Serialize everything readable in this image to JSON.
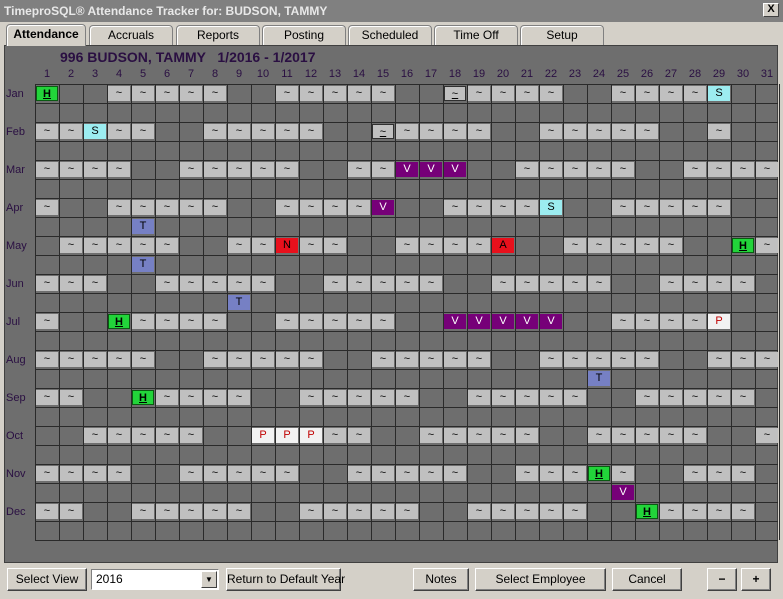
{
  "window": {
    "title": "TimeproSQL® Attendance Tracker for: BUDSON, TAMMY",
    "close_label": "X"
  },
  "tabs": [
    {
      "label": "Attendance",
      "active": true
    },
    {
      "label": "Accruals",
      "active": false
    },
    {
      "label": "Reports",
      "active": false
    },
    {
      "label": "Posting",
      "active": false
    },
    {
      "label": "Scheduled",
      "active": false
    },
    {
      "label": "Time Off",
      "active": false
    },
    {
      "label": "Setup",
      "active": false
    }
  ],
  "heading": "996 BUDSON, TAMMY   1/2016 - 1/2017",
  "days": [
    "1",
    "2",
    "3",
    "4",
    "5",
    "6",
    "7",
    "8",
    "9",
    "10",
    "11",
    "12",
    "13",
    "14",
    "15",
    "16",
    "17",
    "18",
    "19",
    "20",
    "21",
    "22",
    "23",
    "24",
    "25",
    "26",
    "27",
    "28",
    "29",
    "30",
    "31"
  ],
  "months": [
    "Jan",
    "Feb",
    "Mar",
    "Apr",
    "May",
    "Jun",
    "Jul",
    "Aug",
    "Sep",
    "Oct",
    "Nov",
    "Dec"
  ],
  "calendar_rows": [
    [
      [
        "H",
        "holiday"
      ],
      [
        "",
        "none"
      ],
      [
        "",
        "none"
      ],
      [
        "~",
        "sched"
      ],
      [
        "~",
        "sched"
      ],
      [
        "~",
        "sched"
      ],
      [
        "~",
        "sched"
      ],
      [
        "~",
        "sched"
      ],
      [
        "",
        "none"
      ],
      [
        "",
        "none"
      ],
      [
        "~",
        "sched"
      ],
      [
        "~",
        "sched"
      ],
      [
        "~",
        "sched"
      ],
      [
        "~",
        "sched"
      ],
      [
        "~",
        "sched"
      ],
      [
        "",
        "none"
      ],
      [
        "",
        "none"
      ],
      [
        "~",
        "today"
      ],
      [
        "~",
        "sched"
      ],
      [
        "~",
        "sched"
      ],
      [
        "~",
        "sched"
      ],
      [
        "~",
        "sched"
      ],
      [
        "",
        "none"
      ],
      [
        "",
        "none"
      ],
      [
        "~",
        "sched"
      ],
      [
        "~",
        "sched"
      ],
      [
        "~",
        "sched"
      ],
      [
        "~",
        "sched"
      ],
      [
        "S",
        "sick"
      ],
      [
        "",
        "none"
      ],
      [
        "",
        "none"
      ]
    ],
    [
      [
        "~",
        "sched"
      ],
      [
        "~",
        "sched"
      ],
      [
        "S",
        "sick"
      ],
      [
        "~",
        "sched"
      ],
      [
        "~",
        "sched"
      ],
      [
        "",
        "none"
      ],
      [
        "",
        "none"
      ],
      [
        "~",
        "sched"
      ],
      [
        "~",
        "sched"
      ],
      [
        "~",
        "sched"
      ],
      [
        "~",
        "sched"
      ],
      [
        "~",
        "sched"
      ],
      [
        "",
        "none"
      ],
      [
        "",
        "none"
      ],
      [
        "~",
        "today"
      ],
      [
        "~",
        "sched"
      ],
      [
        "~",
        "sched"
      ],
      [
        "~",
        "sched"
      ],
      [
        "~",
        "sched"
      ],
      [
        "",
        "none"
      ],
      [
        "",
        "none"
      ],
      [
        "~",
        "sched"
      ],
      [
        "~",
        "sched"
      ],
      [
        "~",
        "sched"
      ],
      [
        "~",
        "sched"
      ],
      [
        "~",
        "sched"
      ],
      [
        "",
        "none"
      ],
      [
        "",
        "none"
      ],
      [
        "~",
        "sched"
      ],
      [
        "",
        "none"
      ],
      [
        "",
        "none"
      ]
    ],
    [
      [
        "~",
        "sched"
      ],
      [
        "~",
        "sched"
      ],
      [
        "~",
        "sched"
      ],
      [
        "~",
        "sched"
      ],
      [
        "",
        "none"
      ],
      [
        "",
        "none"
      ],
      [
        "~",
        "sched"
      ],
      [
        "~",
        "sched"
      ],
      [
        "~",
        "sched"
      ],
      [
        "~",
        "sched"
      ],
      [
        "~",
        "sched"
      ],
      [
        "",
        "none"
      ],
      [
        "",
        "none"
      ],
      [
        "~",
        "sched"
      ],
      [
        "~",
        "sched"
      ],
      [
        "V",
        "vac"
      ],
      [
        "V",
        "vac"
      ],
      [
        "V",
        "vac"
      ],
      [
        "",
        "none"
      ],
      [
        "",
        "none"
      ],
      [
        "~",
        "sched"
      ],
      [
        "~",
        "sched"
      ],
      [
        "~",
        "sched"
      ],
      [
        "~",
        "sched"
      ],
      [
        "~",
        "sched"
      ],
      [
        "",
        "none"
      ],
      [
        "",
        "none"
      ],
      [
        "~",
        "sched"
      ],
      [
        "~",
        "sched"
      ],
      [
        "~",
        "sched"
      ],
      [
        "~",
        "sched"
      ]
    ],
    [
      [
        "~",
        "sched"
      ],
      [
        "",
        "none"
      ],
      [
        "",
        "none"
      ],
      [
        "~",
        "sched"
      ],
      [
        "~",
        "sched"
      ],
      [
        "~",
        "sched"
      ],
      [
        "~",
        "sched"
      ],
      [
        "~",
        "sched"
      ],
      [
        "",
        "none"
      ],
      [
        "",
        "none"
      ],
      [
        "~",
        "sched"
      ],
      [
        "~",
        "sched"
      ],
      [
        "~",
        "sched"
      ],
      [
        "~",
        "sched"
      ],
      [
        "V",
        "vac"
      ],
      [
        "",
        "none"
      ],
      [
        "",
        "none"
      ],
      [
        "~",
        "sched"
      ],
      [
        "~",
        "sched"
      ],
      [
        "~",
        "sched"
      ],
      [
        "~",
        "sched"
      ],
      [
        "S",
        "sick"
      ],
      [
        "",
        "none"
      ],
      [
        "",
        "none"
      ],
      [
        "~",
        "sched"
      ],
      [
        "~",
        "sched"
      ],
      [
        "~",
        "sched"
      ],
      [
        "~",
        "sched"
      ],
      [
        "~",
        "sched"
      ],
      [
        "",
        "none"
      ],
      [
        "",
        "none"
      ]
    ],
    [
      [
        "",
        "none"
      ],
      [
        "~",
        "sched"
      ],
      [
        "~",
        "sched"
      ],
      [
        "~",
        "sched"
      ],
      [
        "~",
        "sched"
      ],
      [
        "~",
        "sched"
      ],
      [
        "",
        "none"
      ],
      [
        "",
        "none"
      ],
      [
        "~",
        "sched"
      ],
      [
        "~",
        "sched"
      ],
      [
        "N",
        "noshow"
      ],
      [
        "~",
        "sched"
      ],
      [
        "~",
        "sched"
      ],
      [
        "",
        "none"
      ],
      [
        "",
        "none"
      ],
      [
        "~",
        "sched"
      ],
      [
        "~",
        "sched"
      ],
      [
        "~",
        "sched"
      ],
      [
        "~",
        "sched"
      ],
      [
        "A",
        "absent"
      ],
      [
        "",
        "none"
      ],
      [
        "",
        "none"
      ],
      [
        "~",
        "sched"
      ],
      [
        "~",
        "sched"
      ],
      [
        "~",
        "sched"
      ],
      [
        "~",
        "sched"
      ],
      [
        "~",
        "sched"
      ],
      [
        "",
        "none"
      ],
      [
        "",
        "none"
      ],
      [
        "H",
        "holiday"
      ],
      [
        "~",
        "sched"
      ]
    ],
    [
      [
        "~",
        "sched"
      ],
      [
        "~",
        "sched"
      ],
      [
        "~",
        "sched"
      ],
      [
        "",
        "none"
      ],
      [
        "",
        "none"
      ],
      [
        "~",
        "sched"
      ],
      [
        "~",
        "sched"
      ],
      [
        "~",
        "sched"
      ],
      [
        "~",
        "sched"
      ],
      [
        "~",
        "sched"
      ],
      [
        "",
        "none"
      ],
      [
        "",
        "none"
      ],
      [
        "~",
        "sched"
      ],
      [
        "~",
        "sched"
      ],
      [
        "~",
        "sched"
      ],
      [
        "~",
        "sched"
      ],
      [
        "~",
        "sched"
      ],
      [
        "",
        "none"
      ],
      [
        "",
        "none"
      ],
      [
        "~",
        "sched"
      ],
      [
        "~",
        "sched"
      ],
      [
        "~",
        "sched"
      ],
      [
        "~",
        "sched"
      ],
      [
        "~",
        "sched"
      ],
      [
        "",
        "none"
      ],
      [
        "",
        "none"
      ],
      [
        "~",
        "sched"
      ],
      [
        "~",
        "sched"
      ],
      [
        "~",
        "sched"
      ],
      [
        "~",
        "sched"
      ],
      [
        "",
        "none"
      ]
    ],
    [
      [
        "~",
        "sched"
      ],
      [
        "",
        "none"
      ],
      [
        "",
        "none"
      ],
      [
        "H",
        "holiday"
      ],
      [
        "~",
        "sched"
      ],
      [
        "~",
        "sched"
      ],
      [
        "~",
        "sched"
      ],
      [
        "~",
        "sched"
      ],
      [
        "",
        "none"
      ],
      [
        "",
        "none"
      ],
      [
        "~",
        "sched"
      ],
      [
        "~",
        "sched"
      ],
      [
        "~",
        "sched"
      ],
      [
        "~",
        "sched"
      ],
      [
        "~",
        "sched"
      ],
      [
        "",
        "none"
      ],
      [
        "",
        "none"
      ],
      [
        "V",
        "vac"
      ],
      [
        "V",
        "vac"
      ],
      [
        "V",
        "vac"
      ],
      [
        "V",
        "vac"
      ],
      [
        "V",
        "vac"
      ],
      [
        "",
        "none"
      ],
      [
        "",
        "none"
      ],
      [
        "~",
        "sched"
      ],
      [
        "~",
        "sched"
      ],
      [
        "~",
        "sched"
      ],
      [
        "~",
        "sched"
      ],
      [
        "P",
        "personal"
      ],
      [
        "",
        "none"
      ],
      [
        "",
        "none"
      ]
    ],
    [
      [
        "~",
        "sched"
      ],
      [
        "~",
        "sched"
      ],
      [
        "~",
        "sched"
      ],
      [
        "~",
        "sched"
      ],
      [
        "~",
        "sched"
      ],
      [
        "",
        "none"
      ],
      [
        "",
        "none"
      ],
      [
        "~",
        "sched"
      ],
      [
        "~",
        "sched"
      ],
      [
        "~",
        "sched"
      ],
      [
        "~",
        "sched"
      ],
      [
        "~",
        "sched"
      ],
      [
        "",
        "none"
      ],
      [
        "",
        "none"
      ],
      [
        "~",
        "sched"
      ],
      [
        "~",
        "sched"
      ],
      [
        "~",
        "sched"
      ],
      [
        "~",
        "sched"
      ],
      [
        "~",
        "sched"
      ],
      [
        "",
        "none"
      ],
      [
        "",
        "none"
      ],
      [
        "~",
        "sched"
      ],
      [
        "~",
        "sched"
      ],
      [
        "~",
        "sched"
      ],
      [
        "~",
        "sched"
      ],
      [
        "~",
        "sched"
      ],
      [
        "",
        "none"
      ],
      [
        "",
        "none"
      ],
      [
        "~",
        "sched"
      ],
      [
        "~",
        "sched"
      ],
      [
        "~",
        "sched"
      ]
    ],
    [
      [
        "~",
        "sched"
      ],
      [
        "~",
        "sched"
      ],
      [
        "",
        "none"
      ],
      [
        "",
        "none"
      ],
      [
        "H",
        "holiday"
      ],
      [
        "~",
        "sched"
      ],
      [
        "~",
        "sched"
      ],
      [
        "~",
        "sched"
      ],
      [
        "~",
        "sched"
      ],
      [
        "",
        "none"
      ],
      [
        "",
        "none"
      ],
      [
        "~",
        "sched"
      ],
      [
        "~",
        "sched"
      ],
      [
        "~",
        "sched"
      ],
      [
        "~",
        "sched"
      ],
      [
        "~",
        "sched"
      ],
      [
        "",
        "none"
      ],
      [
        "",
        "none"
      ],
      [
        "~",
        "sched"
      ],
      [
        "~",
        "sched"
      ],
      [
        "~",
        "sched"
      ],
      [
        "~",
        "sched"
      ],
      [
        "~",
        "sched"
      ],
      [
        "",
        "none"
      ],
      [
        "",
        "none"
      ],
      [
        "~",
        "sched"
      ],
      [
        "~",
        "sched"
      ],
      [
        "~",
        "sched"
      ],
      [
        "~",
        "sched"
      ],
      [
        "~",
        "sched"
      ],
      [
        "",
        "none"
      ]
    ],
    [
      [
        "",
        "none"
      ],
      [
        "",
        "none"
      ],
      [
        "~",
        "sched"
      ],
      [
        "~",
        "sched"
      ],
      [
        "~",
        "sched"
      ],
      [
        "~",
        "sched"
      ],
      [
        "~",
        "sched"
      ],
      [
        "",
        "none"
      ],
      [
        "",
        "none"
      ],
      [
        "P",
        "personal"
      ],
      [
        "P",
        "personal"
      ],
      [
        "P",
        "personal"
      ],
      [
        "~",
        "sched"
      ],
      [
        "~",
        "sched"
      ],
      [
        "",
        "none"
      ],
      [
        "",
        "none"
      ],
      [
        "~",
        "sched"
      ],
      [
        "~",
        "sched"
      ],
      [
        "~",
        "sched"
      ],
      [
        "~",
        "sched"
      ],
      [
        "~",
        "sched"
      ],
      [
        "",
        "none"
      ],
      [
        "",
        "none"
      ],
      [
        "~",
        "sched"
      ],
      [
        "~",
        "sched"
      ],
      [
        "~",
        "sched"
      ],
      [
        "~",
        "sched"
      ],
      [
        "~",
        "sched"
      ],
      [
        "",
        "none"
      ],
      [
        "",
        "none"
      ],
      [
        "~",
        "sched"
      ]
    ],
    [
      [
        "~",
        "sched"
      ],
      [
        "~",
        "sched"
      ],
      [
        "~",
        "sched"
      ],
      [
        "~",
        "sched"
      ],
      [
        "",
        "none"
      ],
      [
        "",
        "none"
      ],
      [
        "~",
        "sched"
      ],
      [
        "~",
        "sched"
      ],
      [
        "~",
        "sched"
      ],
      [
        "~",
        "sched"
      ],
      [
        "~",
        "sched"
      ],
      [
        "",
        "none"
      ],
      [
        "",
        "none"
      ],
      [
        "~",
        "sched"
      ],
      [
        "~",
        "sched"
      ],
      [
        "~",
        "sched"
      ],
      [
        "~",
        "sched"
      ],
      [
        "~",
        "sched"
      ],
      [
        "",
        "none"
      ],
      [
        "",
        "none"
      ],
      [
        "~",
        "sched"
      ],
      [
        "~",
        "sched"
      ],
      [
        "~",
        "sched"
      ],
      [
        "H",
        "holiday"
      ],
      [
        "~",
        "sched"
      ],
      [
        "",
        "none"
      ],
      [
        "",
        "none"
      ],
      [
        "~",
        "sched"
      ],
      [
        "~",
        "sched"
      ],
      [
        "~",
        "sched"
      ],
      [
        "",
        "none"
      ]
    ],
    [
      [
        "~",
        "sched"
      ],
      [
        "~",
        "sched"
      ],
      [
        "",
        "none"
      ],
      [
        "",
        "none"
      ],
      [
        "~",
        "sched"
      ],
      [
        "~",
        "sched"
      ],
      [
        "~",
        "sched"
      ],
      [
        "~",
        "sched"
      ],
      [
        "~",
        "sched"
      ],
      [
        "",
        "none"
      ],
      [
        "",
        "none"
      ],
      [
        "~",
        "sched"
      ],
      [
        "~",
        "sched"
      ],
      [
        "~",
        "sched"
      ],
      [
        "~",
        "sched"
      ],
      [
        "~",
        "sched"
      ],
      [
        "",
        "none"
      ],
      [
        "",
        "none"
      ],
      [
        "~",
        "sched"
      ],
      [
        "~",
        "sched"
      ],
      [
        "~",
        "sched"
      ],
      [
        "~",
        "sched"
      ],
      [
        "~",
        "sched"
      ],
      [
        "",
        "none"
      ],
      [
        "",
        "none"
      ],
      [
        "H",
        "holiday"
      ],
      [
        "~",
        "sched"
      ],
      [
        "~",
        "sched"
      ],
      [
        "~",
        "sched"
      ],
      [
        "~",
        "sched"
      ],
      [
        "",
        "none"
      ]
    ]
  ],
  "extra_rows": [
    [],
    [],
    [],
    [
      [
        5,
        "T",
        "train"
      ]
    ],
    [
      [
        5,
        "T",
        "train"
      ]
    ],
    [
      [
        9,
        "T",
        "train"
      ]
    ],
    [],
    [
      [
        24,
        "T",
        "train"
      ]
    ],
    [],
    [],
    [
      [
        25,
        "V",
        "vac"
      ]
    ],
    []
  ],
  "bottom": {
    "select_view": "Select View",
    "year_value": "2016",
    "dropdown_arrow": "▼",
    "default_year": "Return to Default Year",
    "notes": "Notes",
    "select_employee": "Select Employee",
    "cancel": "Cancel",
    "minus": "−",
    "plus": "+"
  }
}
